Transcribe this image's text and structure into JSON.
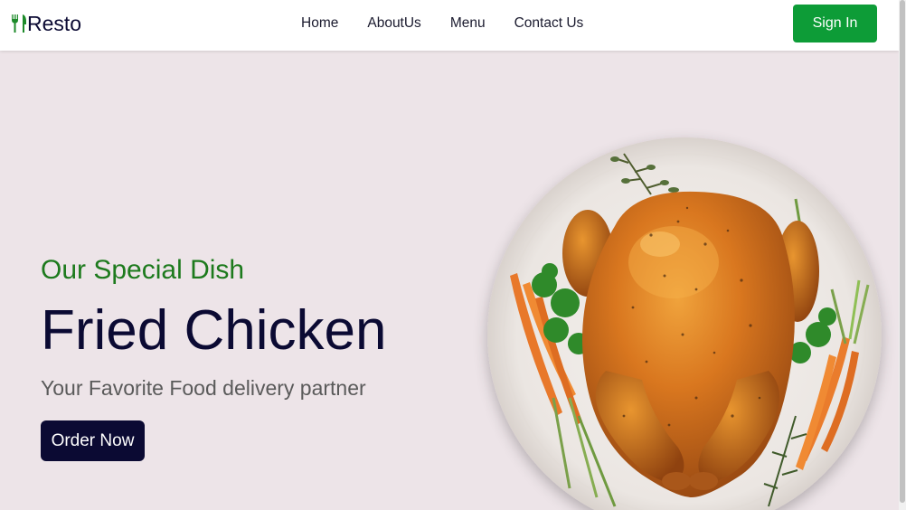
{
  "header": {
    "logo_text": "Resto",
    "logo_icon": "fork-knife-icon",
    "nav": [
      "Home",
      "AboutUs",
      "Menu",
      "Contact Us"
    ],
    "signin_label": "Sign In"
  },
  "hero": {
    "subtitle": "Our Special Dish",
    "title": "Fried Chicken",
    "tagline": "Your Favorite Food delivery partner",
    "order_label": "Order Now",
    "image": "roast-chicken-plate"
  },
  "colors": {
    "brand_green": "#0d9c37",
    "subtitle_green": "#1d7a1d",
    "navy": "#0b0a33",
    "background": "#ede4e8"
  }
}
